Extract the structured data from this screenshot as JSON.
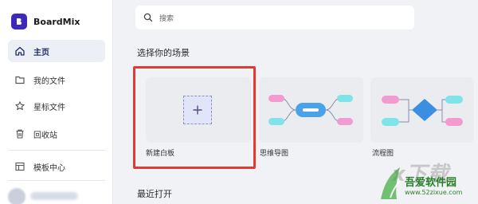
{
  "app": {
    "name": "BoardMix"
  },
  "sidebar": {
    "items": [
      {
        "label": "主页",
        "icon": "home-icon",
        "active": true
      },
      {
        "label": "我的文件",
        "icon": "folder-icon"
      },
      {
        "label": "星标文件",
        "icon": "star-icon"
      },
      {
        "label": "回收站",
        "icon": "trash-icon"
      },
      {
        "label": "模板中心",
        "icon": "template-icon"
      }
    ]
  },
  "search": {
    "placeholder": "搜索"
  },
  "main": {
    "section_scene": "选择你的场景",
    "cards": [
      {
        "label": "新建白板"
      },
      {
        "label": "思维导图"
      },
      {
        "label": "流程图"
      }
    ],
    "section_recent": "最近打开"
  },
  "watermark": {
    "text_en": "x下载",
    "text_cn": "吾爱软件园",
    "url": "www.52zixue.com"
  },
  "colors": {
    "brand": "#3b2bb8",
    "highlight": "#e53935",
    "mindmap_center": "#4aa3e8",
    "flow_diamond": "#3b8fe0",
    "pink": "#f39bd1",
    "cyan": "#7fe3ea"
  }
}
